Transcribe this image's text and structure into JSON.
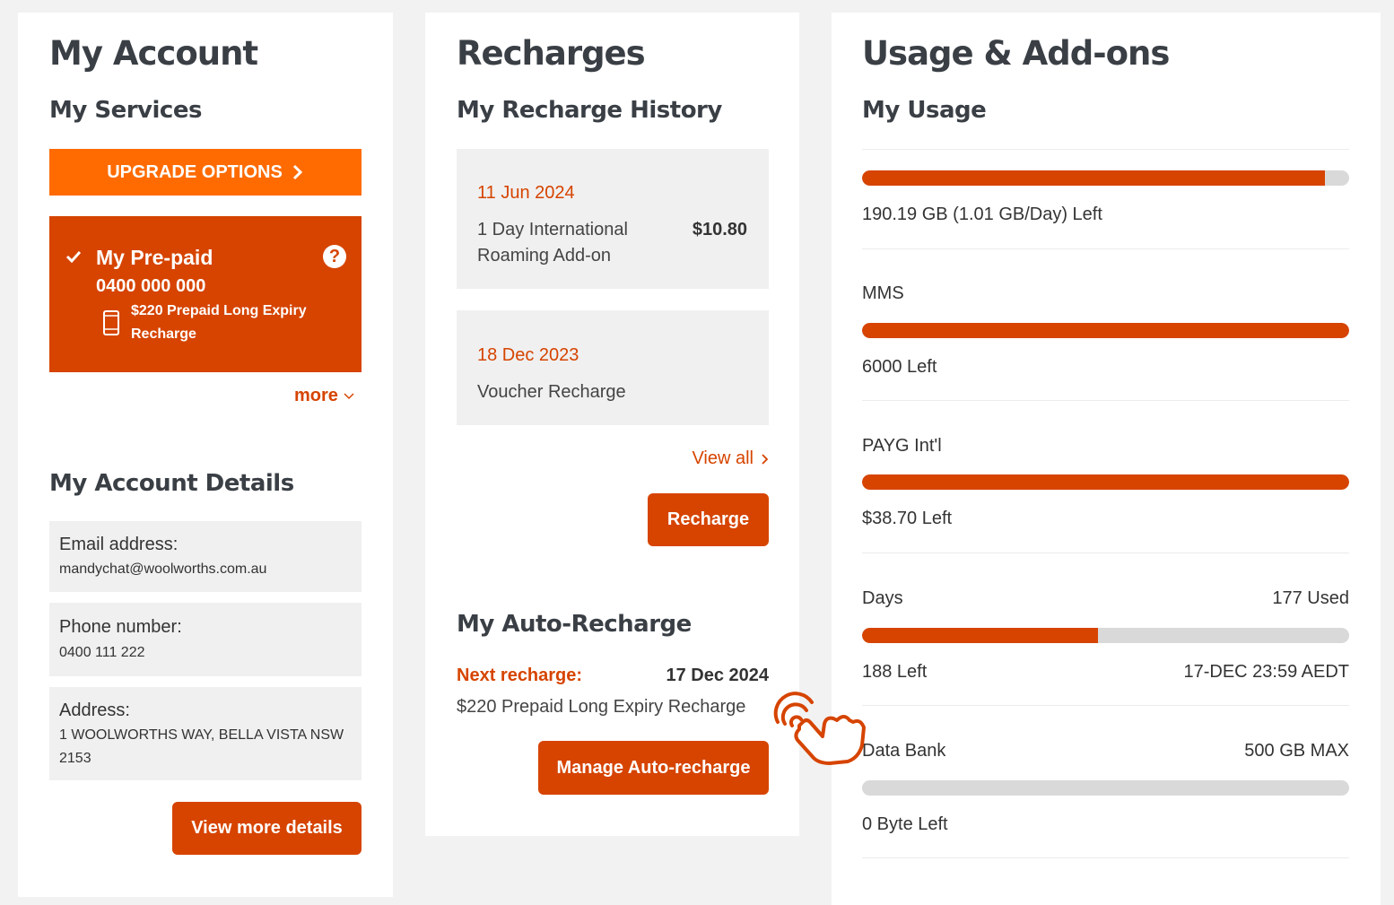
{
  "account": {
    "title": "My Account",
    "services_heading": "My Services",
    "upgrade_label": "UPGRADE OPTIONS",
    "service": {
      "name": "My Pre-paid",
      "number": "0400 000 000",
      "plan_line1": "$220 Prepaid Long Expiry",
      "plan_line2": "Recharge"
    },
    "more_label": "more",
    "details_heading": "My Account Details",
    "details": [
      {
        "label": "Email address:",
        "value": "mandychat@woolworths.com.au"
      },
      {
        "label": "Phone number:",
        "value": "0400 111 222"
      },
      {
        "label": "Address:",
        "value_line1": "1 WOOLWORTHS WAY, BELLA VISTA NSW",
        "value_line2": "2153"
      }
    ],
    "view_more_label": "View more details"
  },
  "recharges": {
    "title": "Recharges",
    "history_heading": "My Recharge History",
    "history": [
      {
        "date": "11 Jun 2024",
        "desc_line1": "1 Day International",
        "desc_line2": "Roaming Add-on",
        "amount": "$10.80"
      },
      {
        "date": "18 Dec 2023",
        "desc_line1": "Voucher Recharge"
      }
    ],
    "view_all_label": "View all",
    "recharge_label": "Recharge",
    "auto_heading": "My Auto-Recharge",
    "next_label": "Next recharge:",
    "next_date": "17 Dec 2024",
    "next_plan": "$220 Prepaid Long Expiry Recharge",
    "manage_label": "Manage Auto-recharge"
  },
  "usage": {
    "title": "Usage & Add-ons",
    "heading": "My Usage",
    "items": [
      {
        "label": "",
        "right": "",
        "fill": 0.951,
        "left_text": "190.19 GB (1.01 GB/Day) Left",
        "right_text": ""
      },
      {
        "label": "MMS",
        "right": "",
        "fill": 1.0,
        "left_text": "6000 Left",
        "right_text": ""
      },
      {
        "label": "PAYG Int'l",
        "right": "",
        "fill": 1.0,
        "left_text": "$38.70 Left",
        "right_text": ""
      },
      {
        "label": "Days",
        "right": "177 Used",
        "fill": 0.485,
        "left_text": "188 Left",
        "right_text": "17-DEC 23:59 AEDT"
      },
      {
        "label": "Data Bank",
        "right": "500 GB MAX",
        "fill": 0,
        "left_text": "0 Byte Left",
        "right_text": ""
      }
    ]
  },
  "colors": {
    "accent": "#d64400",
    "upgrade": "#ff6b00"
  }
}
